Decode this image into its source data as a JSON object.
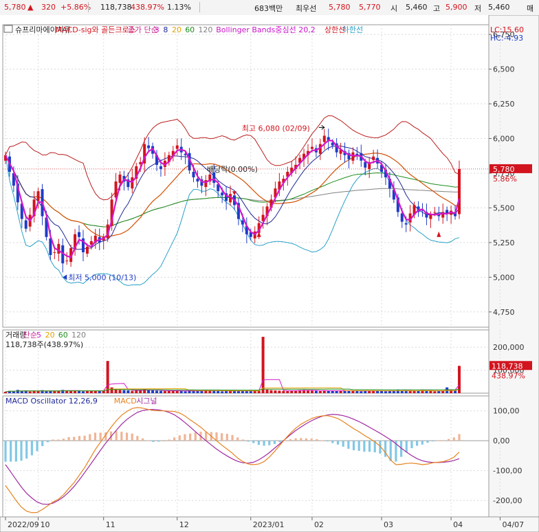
{
  "ticker_bar": {
    "price": "5,780",
    "change_arrow": "▲",
    "change": "320",
    "change_pct": "+5.86%",
    "volume": "118,738",
    "volume_ratio": "438.97%",
    "turnover_pct": "1.13%",
    "amount": "683백만",
    "best_label": "최우선",
    "best_ask": "5,780",
    "best_bid": "5,770",
    "open_label": "시",
    "open": "5,460",
    "high_label": "고",
    "high": "5,900",
    "low_label": "저",
    "low": "5,460",
    "extra_label": "매"
  },
  "colors": {
    "up": "#d2141e",
    "down": "#1e3cc8",
    "ma3": "#d218c8",
    "ma8": "#1e2896",
    "ma20": "#e6a000",
    "ma60": "#1e8c1e",
    "ma120": "#808080",
    "bb_mid": "#d24614",
    "bb_upper": "#b91e1e",
    "bb_lower": "#28a0c8",
    "macd": "#e6821e",
    "signal": "#a028a0",
    "osc_pos": "#f0b496",
    "osc_neg": "#82c8e6"
  },
  "price_panel": {
    "legend": [
      {
        "text": "슈프리마에이치큐",
        "color": "#222222"
      },
      {
        "text": "MACD-sig와 골든크로스",
        "color": "#d2141e"
      },
      {
        "text": "종가 단순",
        "color": "#c8288c"
      },
      {
        "text": "3",
        "color": "#d218c8"
      },
      {
        "text": "8",
        "color": "#1e2896"
      },
      {
        "text": "20",
        "color": "#e6a000"
      },
      {
        "text": "60",
        "color": "#1e8c1e"
      },
      {
        "text": "120",
        "color": "#808080"
      },
      {
        "text": "Bollinger Bands중심선 20,2",
        "color": "#c814c8"
      },
      {
        "text": "상한선",
        "color": "#d2141e"
      },
      {
        "text": "하한선",
        "color": "#28a0c8"
      }
    ],
    "lc_label": "LC:15.60",
    "hc_label": "HC:-4.93",
    "y_ticks": [
      {
        "v": 6750,
        "label": "6,750"
      },
      {
        "v": 6500,
        "label": "6,500"
      },
      {
        "v": 6250,
        "label": "6,250"
      },
      {
        "v": 6000,
        "label": "6,000"
      },
      {
        "v": 5750,
        "label": "5,750"
      },
      {
        "v": 5500,
        "label": "5,500"
      },
      {
        "v": 5250,
        "label": "5,250"
      },
      {
        "v": 5000,
        "label": "5,000"
      },
      {
        "v": 4750,
        "label": "4,750"
      }
    ],
    "price_tag": "5,780",
    "price_tag_value": 5780,
    "pct_tag": "5.86%",
    "annotations": {
      "high": {
        "text": "최고 6,080 (02/09)",
        "value": 6080,
        "index": 78
      },
      "low": {
        "text": "최저 5,000 (10/13)",
        "value": 5000,
        "index": 14
      },
      "dividend": {
        "text": "배당락(0.00%)",
        "index": 56
      }
    }
  },
  "volume_panel": {
    "legend": [
      {
        "text": "거래량",
        "color": "#222222"
      },
      {
        "text": "단순",
        "color": "#c8288c"
      },
      {
        "text": "5",
        "color": "#c814c8"
      },
      {
        "text": "20",
        "color": "#e6a000"
      },
      {
        "text": "60",
        "color": "#1e8c1e"
      },
      {
        "text": "120",
        "color": "#808080"
      }
    ],
    "subtitle": "118,738주(438.97%)",
    "y_ticks": [
      {
        "v": 200000,
        "label": "200,000"
      },
      {
        "v": 100000,
        "label": "100,000"
      }
    ],
    "tag": "118,738",
    "tag_value": 118738,
    "tag_pct": "438.97%"
  },
  "macd_panel": {
    "legend": [
      {
        "text": "MACD Oscillator 12,26,9",
        "color": "#1e2896"
      },
      {
        "text": "MACD",
        "color": "#e6821e"
      },
      {
        "text": "시그널",
        "color": "#a028a0"
      }
    ],
    "y_ticks": [
      {
        "v": 100,
        "label": "100,00"
      },
      {
        "v": 0,
        "label": "0,00"
      },
      {
        "v": -100,
        "label": "-100,00"
      },
      {
        "v": -200,
        "label": "-200,00"
      }
    ]
  },
  "x_axis": {
    "labels": [
      {
        "text": "2022/09",
        "index": 0
      },
      {
        "text": "10",
        "index": 8
      },
      {
        "text": "11",
        "index": 24
      },
      {
        "text": "12",
        "index": 42
      },
      {
        "text": "2023/01",
        "index": 60
      },
      {
        "text": "02",
        "index": 75
      },
      {
        "text": "03",
        "index": 92
      },
      {
        "text": "04",
        "index": 109
      },
      {
        "text": "04/07",
        "index": 121
      }
    ]
  },
  "chart_data": {
    "type": "candlestick",
    "price_axis": {
      "min": 4640,
      "max": 6820
    },
    "volume_axis": {
      "min": 0,
      "max": 275000
    },
    "macd_axis": {
      "min": -255,
      "max": 150
    },
    "close": [
      5880,
      5760,
      5660,
      5540,
      5420,
      5350,
      5450,
      5560,
      5620,
      5440,
      5290,
      5160,
      5180,
      5240,
      5100,
      5120,
      5210,
      5310,
      5290,
      5180,
      5220,
      5260,
      5300,
      5250,
      5290,
      5380,
      5560,
      5690,
      5740,
      5690,
      5650,
      5720,
      5800,
      5830,
      5960,
      5930,
      5890,
      5810,
      5780,
      5840,
      5880,
      5910,
      5950,
      5900,
      5880,
      5770,
      5720,
      5690,
      5660,
      5700,
      5740,
      5680,
      5620,
      5590,
      5550,
      5600,
      5520,
      5420,
      5380,
      5310,
      5290,
      5330,
      5390,
      5450,
      5510,
      5560,
      5640,
      5690,
      5710,
      5760,
      5790,
      5810,
      5860,
      5890,
      5910,
      5940,
      5900,
      5960,
      6020,
      5980,
      5950,
      5900,
      5920,
      5880,
      5850,
      5900,
      5880,
      5840,
      5790,
      5830,
      5870,
      5820,
      5760,
      5720,
      5640,
      5560,
      5470,
      5400,
      5380,
      5460,
      5520,
      5470,
      5480,
      5430,
      5450,
      5470,
      5440,
      5470,
      5460,
      5480,
      5440,
      5780
    ],
    "volume": [
      6000,
      10000,
      8000,
      14000,
      9000,
      12000,
      7000,
      11000,
      9000,
      13000,
      8000,
      10000,
      9000,
      11000,
      14000,
      12000,
      10000,
      9000,
      12000,
      8000,
      10000,
      9000,
      11000,
      10000,
      12000,
      140000,
      25000,
      18000,
      14000,
      13000,
      12000,
      10000,
      11000,
      15000,
      18000,
      13000,
      12000,
      11000,
      10000,
      9000,
      11000,
      12000,
      10000,
      9000,
      8000,
      12000,
      10000,
      9000,
      11000,
      13000,
      12000,
      10000,
      9000,
      8000,
      10000,
      12000,
      9000,
      11000,
      10000,
      9000,
      11000,
      12000,
      10000,
      245000,
      15000,
      13000,
      12000,
      11000,
      10000,
      9000,
      11000,
      12000,
      13000,
      14000,
      12000,
      11000,
      10000,
      9000,
      12000,
      11000,
      10000,
      9000,
      10000,
      11000,
      12000,
      10000,
      9000,
      8000,
      10000,
      11000,
      12000,
      10000,
      9000,
      8000,
      11000,
      12000,
      13000,
      10000,
      9000,
      10000,
      11000,
      12000,
      13000,
      10000,
      9000,
      8000,
      10000,
      11000,
      25000,
      15000,
      12000,
      118738
    ],
    "macd_line": [
      -150,
      -175,
      -200,
      -222,
      -236,
      -241,
      -240,
      -230,
      -218,
      -205,
      -196,
      -181,
      -160,
      -140,
      -115,
      -90,
      -60,
      -30,
      -5,
      20,
      45,
      67,
      85,
      98,
      108,
      111,
      109,
      105,
      101,
      100,
      100,
      99,
      98,
      93,
      83,
      70,
      58,
      45,
      30,
      15,
      0,
      -15,
      -28,
      -42,
      -58,
      -70,
      -78,
      -80,
      -78,
      -70,
      -55,
      -36,
      -15,
      6,
      25,
      42,
      55,
      65,
      74,
      80,
      83,
      84,
      80,
      74,
      64,
      52,
      40,
      30,
      18,
      8,
      -4,
      -18,
      -40,
      -65,
      -80,
      -79,
      -76,
      -75,
      -77,
      -80,
      -78,
      -74,
      -72,
      -70,
      -64,
      -55,
      -38
    ],
    "signal_line": [
      -80,
      -105,
      -130,
      -155,
      -176,
      -192,
      -205,
      -212,
      -213,
      -209,
      -200,
      -188,
      -172,
      -153,
      -131,
      -107,
      -82,
      -57,
      -32,
      -8,
      14,
      35,
      55,
      71,
      84,
      95,
      101,
      104,
      105,
      103,
      100,
      95,
      87,
      75,
      61,
      46,
      30,
      15,
      0,
      -14,
      -28,
      -40,
      -51,
      -61,
      -69,
      -74,
      -75,
      -72,
      -64,
      -53,
      -40,
      -25,
      -10,
      5,
      20,
      34,
      46,
      57,
      67,
      75,
      82,
      86,
      88,
      87,
      84,
      79,
      72,
      64,
      55,
      45,
      35,
      25,
      14,
      3,
      -10,
      -25,
      -38,
      -50,
      -60,
      -67,
      -71,
      -73,
      -73,
      -72,
      -70,
      -66,
      -60
    ],
    "x_categories_count": 112
  }
}
